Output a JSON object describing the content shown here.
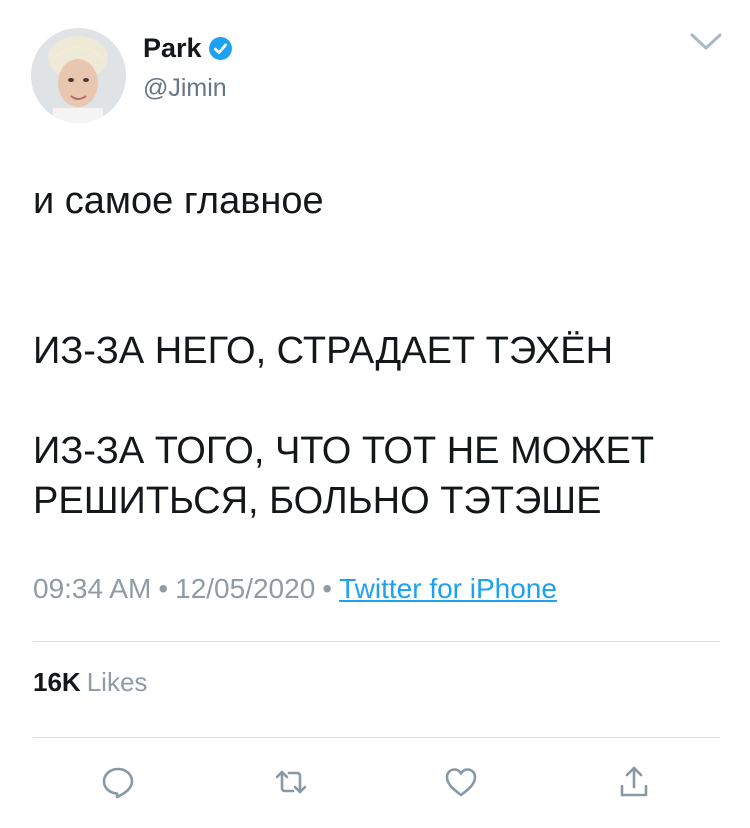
{
  "author": {
    "display_name": "Park",
    "handle": "@Jimin",
    "verified": true
  },
  "tweet": {
    "text": "и самое главное\n\n\nИЗ-ЗА НЕГО, СТРАДАЕТ ТЭХЁН\n\nИЗ-ЗА ТОГО, ЧТО ТОТ НЕ МОЖЕТ РЕШИТЬСЯ, БОЛЬНО ТЭТЭШЕ",
    "time": "09:34 AM",
    "separator": "•",
    "date": "12/05/2020",
    "source": "Twitter for iPhone"
  },
  "stats": {
    "likes_count": "16K",
    "likes_label": "Likes"
  },
  "actions": {
    "icons": [
      "reply-icon",
      "retweet-icon",
      "like-icon",
      "share-icon"
    ]
  },
  "colors": {
    "link": "#1da1f2",
    "verified": "#1da1f2",
    "secondary_text": "#8f9ba5",
    "icon": "#8899a6",
    "divider": "#d8dde2"
  }
}
